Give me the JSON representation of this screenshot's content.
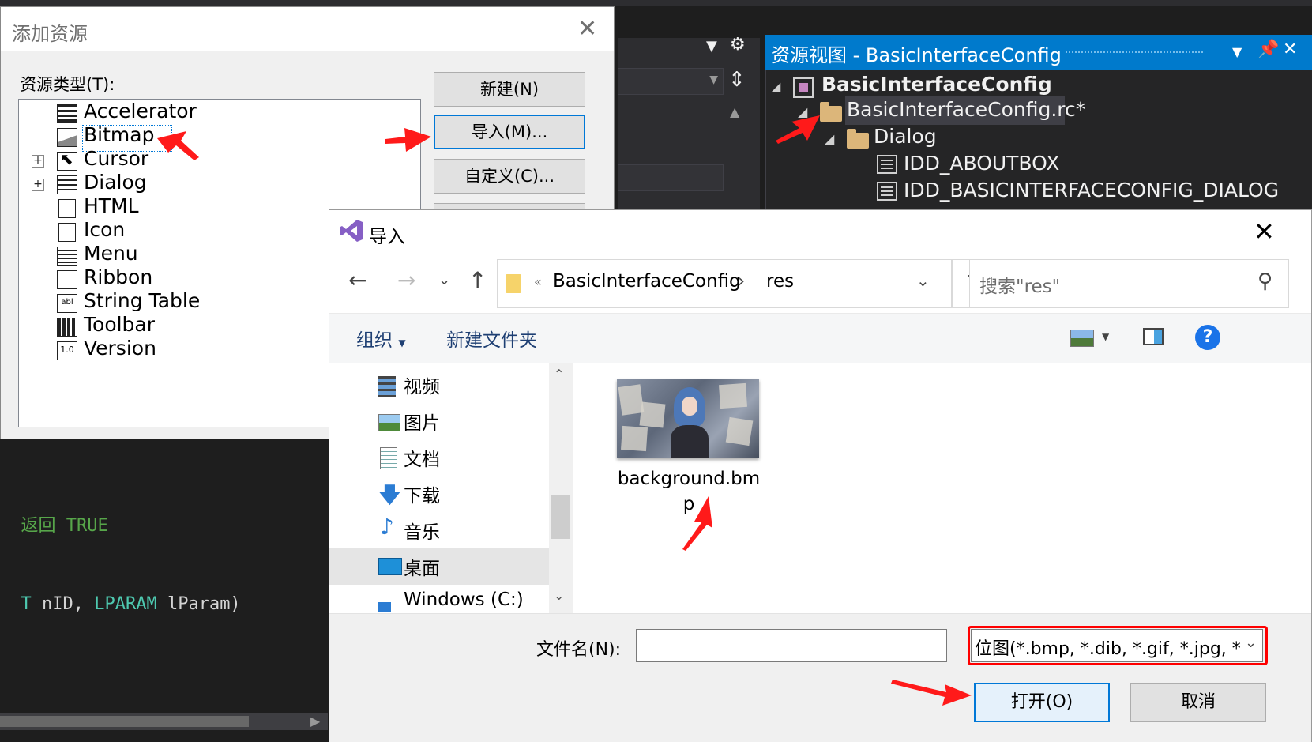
{
  "code": {
    "line1_a": "返回 ",
    "line1_b": "TRUE",
    "line2_a": "T",
    "line2_b": " nID, ",
    "line2_c": "LPARAM",
    "line2_d": " lParam)"
  },
  "resource_view": {
    "title": "资源视图 - BasicInterfaceConfig",
    "root": "BasicInterfaceConfig",
    "rc_file": "BasicInterfaceConfig.rc*",
    "dialog_folder": "Dialog",
    "items": [
      "IDD_ABOUTBOX",
      "IDD_BASICINTERFACECONFIG_DIALOG"
    ]
  },
  "add_resource": {
    "title": "添加资源",
    "type_label": "资源类型(T):",
    "types": [
      "Accelerator",
      "Bitmap",
      "Cursor",
      "Dialog",
      "HTML",
      "Icon",
      "Menu",
      "Ribbon",
      "String Table",
      "Toolbar",
      "Version"
    ],
    "buttons": {
      "new": "新建(N)",
      "import": "导入(M)...",
      "custom": "自定义(C)..."
    }
  },
  "import_dialog": {
    "title": "导入",
    "breadcrumb": [
      "BasicInterfaceConfig",
      "res"
    ],
    "search_placeholder": "搜索\"res\"",
    "toolbar": {
      "organize": "组织",
      "new_folder": "新建文件夹"
    },
    "nav_items": [
      "视频",
      "图片",
      "文档",
      "下载",
      "音乐",
      "桌面",
      "Windows (C:)"
    ],
    "selected_nav": "桌面",
    "file": {
      "name_line1": "background.bm",
      "name_line2": "p"
    },
    "filename_label": "文件名(N):",
    "filename_value": "",
    "filetype": "位图(*.bmp, *.dib, *.gif, *.jpg, *",
    "open_button": "打开(O)",
    "cancel_button": "取消"
  },
  "colors": {
    "accent": "#007acc",
    "annotation_red": "#ff0000",
    "code_green": "#57a64a",
    "code_type": "#4ec9b0"
  }
}
